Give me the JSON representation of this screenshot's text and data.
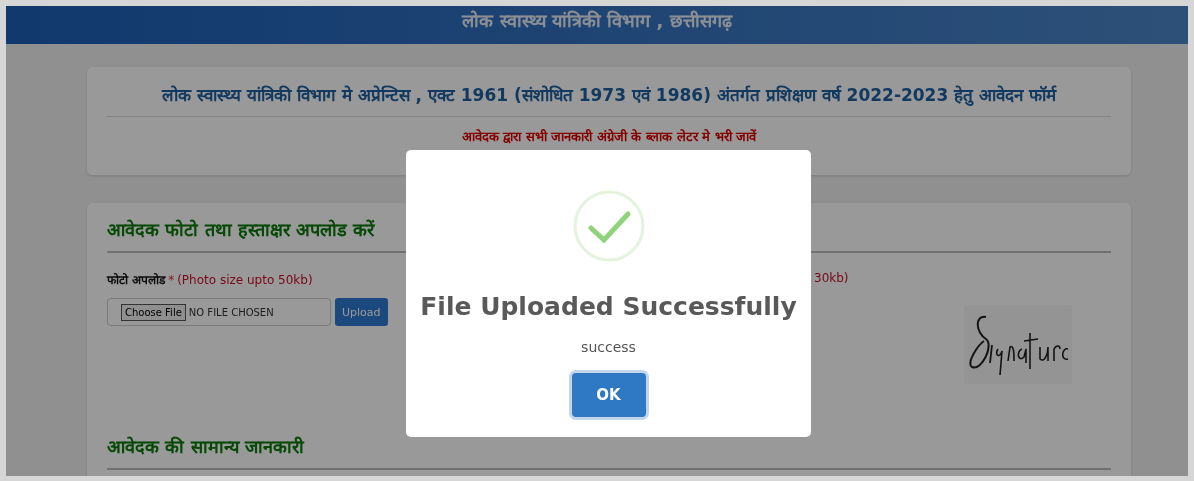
{
  "header": {
    "title": "लोक स्वास्थ्य यांत्रिकी विभाग , छत्तीसगढ़"
  },
  "intro_card": {
    "title": "लोक स्वास्थ्य यांत्रिकी विभाग मे अप्रेन्टिस , एक्ट 1961 (संशोधित 1973 एवं 1986) अंतर्गत प्रशिक्षण वर्ष 2022-2023 हेतु आवेदन फॉर्म",
    "note": "आवेदक द्वारा सभी जानकारी अंग्रेजी के ब्लाक लेटर मे भरी जावें"
  },
  "upload_section": {
    "heading": "आवेदक फोटो तथा हस्ताक्षर अपलोड करें",
    "photo": {
      "label": "फोटो अपलोड",
      "required_mark": "*",
      "hint": "(Photo size upto 50kb)",
      "choose_button": "Choose File",
      "file_status": "NO FILE CHOSEN",
      "upload_button": "Upload"
    },
    "signature": {
      "hint": "30kb)"
    }
  },
  "general_section": {
    "heading": "आवेदक की सामान्य जानकारी"
  },
  "dialog": {
    "title": "File Uploaded Successfully",
    "message": "success",
    "confirm_button": "OK"
  }
}
